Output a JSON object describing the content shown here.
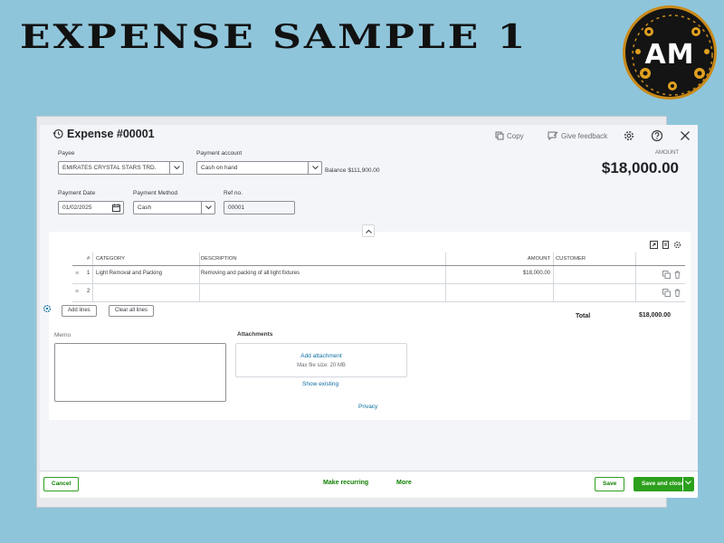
{
  "banner": {
    "title": "EXPENSE SAMPLE 1",
    "logo_text": "AM"
  },
  "header": {
    "title": "Expense #00001",
    "copy_label": "Copy",
    "feedback_label": "Give feedback"
  },
  "form": {
    "payee_label": "Payee",
    "payee_value": "EMIRATES CRYSTAL STARS TRD.",
    "payment_account_label": "Payment account",
    "payment_account_value": "Cash on hand",
    "balance_label": "Balance",
    "balance_value": "$111,900.00",
    "amount_label": "AMOUNT",
    "amount_value": "$18,000.00",
    "payment_date_label": "Payment Date",
    "payment_date_value": "01/02/2025",
    "payment_method_label": "Payment Method",
    "payment_method_value": "Cash",
    "ref_label": "Ref no.",
    "ref_value": "00001"
  },
  "table": {
    "headers": {
      "num": "#",
      "category": "CATEGORY",
      "description": "DESCRIPTION",
      "amount": "AMOUNT",
      "customer": "CUSTOMER"
    },
    "rows": [
      {
        "num": "1",
        "category": "Light Removal and Packing",
        "description": "Removing and packing of all light fixtures",
        "amount": "$18,000.00",
        "customer": ""
      },
      {
        "num": "2",
        "category": "",
        "description": "",
        "amount": "",
        "customer": ""
      }
    ],
    "add_lines_label": "Add lines",
    "clear_lines_label": "Clear all lines",
    "total_label": "Total",
    "total_value": "$18,000.00"
  },
  "memo": {
    "label": "Memo",
    "value": ""
  },
  "attachments": {
    "label": "Attachments",
    "add_label": "Add attachment",
    "max_size": "Max file size: 20 MB",
    "show_existing": "Show existing"
  },
  "privacy_label": "Privacy",
  "footer": {
    "cancel_label": "Cancel",
    "make_recurring_label": "Make recurring",
    "more_label": "More",
    "save_label": "Save",
    "save_close_label": "Save and close"
  },
  "colors": {
    "accent_green": "#2ca01c",
    "link_blue": "#0d6ea0",
    "background": "#8fc5da"
  }
}
